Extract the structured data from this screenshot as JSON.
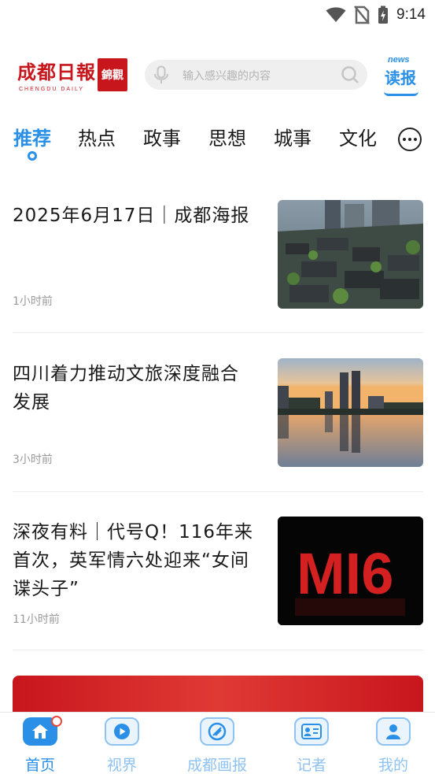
{
  "status_bar": {
    "time": "9:14",
    "icons": [
      "wifi-icon",
      "no-sim-icon",
      "battery-charging-icon"
    ]
  },
  "header": {
    "logo_text": "成都日報",
    "logo_en": "CHENGDU DAILY",
    "logo_badge": "錦觀",
    "search_placeholder": "输入感兴趣的内容",
    "dubao_news": "news",
    "dubao_label": "读报"
  },
  "tabs": [
    {
      "label": "推荐",
      "active": true
    },
    {
      "label": "热点"
    },
    {
      "label": "政事"
    },
    {
      "label": "思想"
    },
    {
      "label": "城事"
    },
    {
      "label": "文化"
    }
  ],
  "news": [
    {
      "title": "2025年6月17日｜成都海报",
      "time": "1小时前",
      "thumb": "aerial-city-photo"
    },
    {
      "title": "四川着力推动文旅深度融合发展",
      "time": "3小时前",
      "thumb": "skyline-reflection-photo"
    },
    {
      "title": "深夜有料｜代号Q！116年来首次，英军情六处迎来“女间谍头子”",
      "time": "11小时前",
      "thumb": "MI6"
    }
  ],
  "bottom_nav": [
    {
      "label": "首页",
      "icon": "home-icon",
      "active": true
    },
    {
      "label": "视界",
      "icon": "play-icon"
    },
    {
      "label": "成都画报",
      "icon": "pictorial-icon"
    },
    {
      "label": "记者",
      "icon": "reporter-card-icon"
    },
    {
      "label": "我的",
      "icon": "user-icon"
    }
  ],
  "colors": {
    "accent": "#2a8fe6",
    "brand_red": "#c8161d"
  }
}
